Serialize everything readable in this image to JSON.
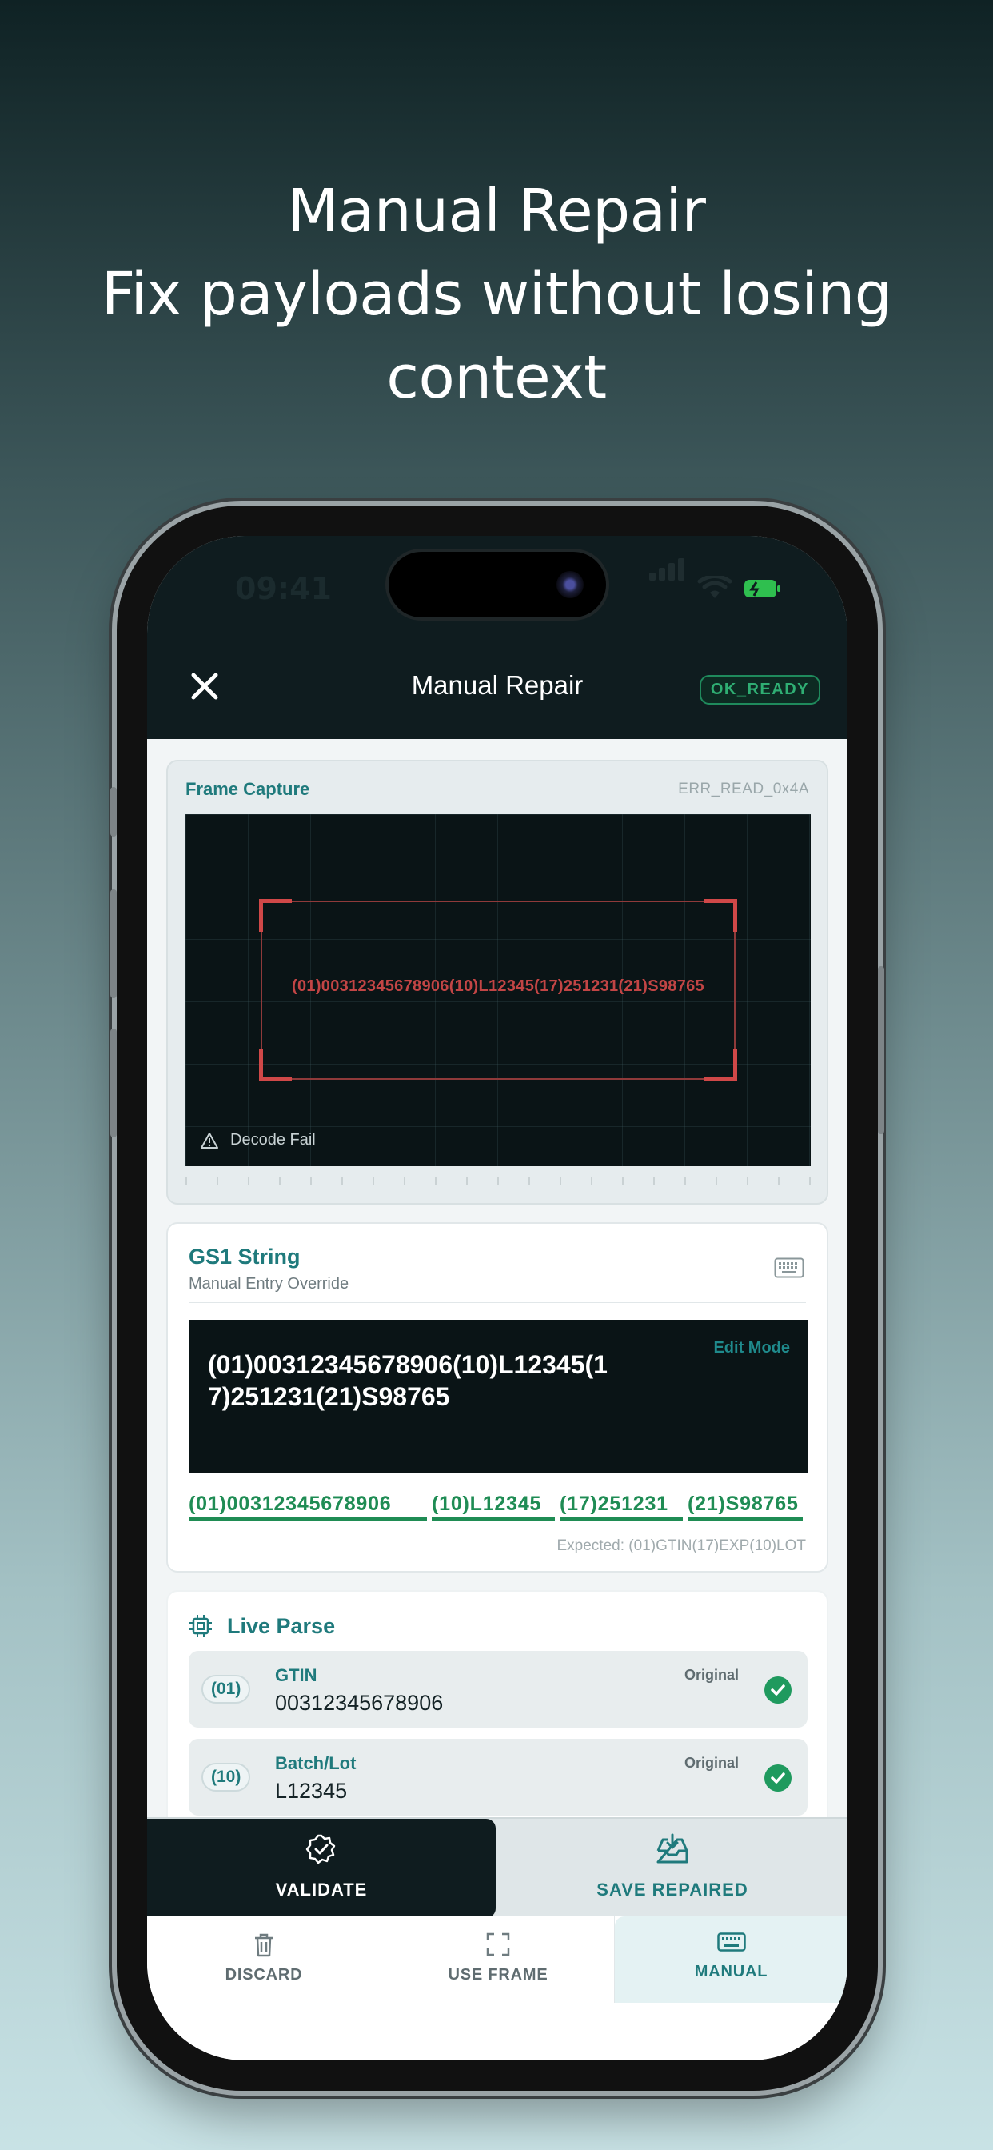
{
  "headline": {
    "line1": "Manual Repair",
    "line2": "Fix payloads without losing",
    "line3": "context"
  },
  "status_bar": {
    "time": "09:41"
  },
  "nav": {
    "title": "Manual Repair",
    "badge": "OK_READY"
  },
  "frame_capture": {
    "title": "Frame Capture",
    "error_code": "ERR_READ_0x4A",
    "captured_text": "(01)00312345678906(10)L12345(17)251231(21)S98765",
    "status": "Decode Fail"
  },
  "gs1": {
    "title": "GS1 String",
    "subtitle": "Manual Entry Override",
    "edit_mode": "Edit Mode",
    "value": "(01)00312345678906(10)L12345(17)251231(21)S98765",
    "segments": [
      "(01)00312345678906",
      "(10)L12345",
      "(17)251231",
      "(21)S98765"
    ],
    "expected": "Expected: (01)GTIN(17)EXP(10)LOT"
  },
  "live_parse": {
    "title": "Live Parse",
    "rows": [
      {
        "ai": "(01)",
        "name": "GTIN",
        "value": "00312345678906",
        "source": "Original"
      },
      {
        "ai": "(10)",
        "name": "Batch/Lot",
        "value": "L12345",
        "source": "Original"
      }
    ]
  },
  "actions": {
    "validate": "VALIDATE",
    "save": "SAVE REPAIRED"
  },
  "bottom_nav": {
    "discard": "DISCARD",
    "use_frame": "USE FRAME",
    "manual": "MANUAL"
  },
  "colors": {
    "accent": "#1f7a7c",
    "success": "#1f8c54",
    "error": "#c24545",
    "dark": "#0f1c1f"
  }
}
